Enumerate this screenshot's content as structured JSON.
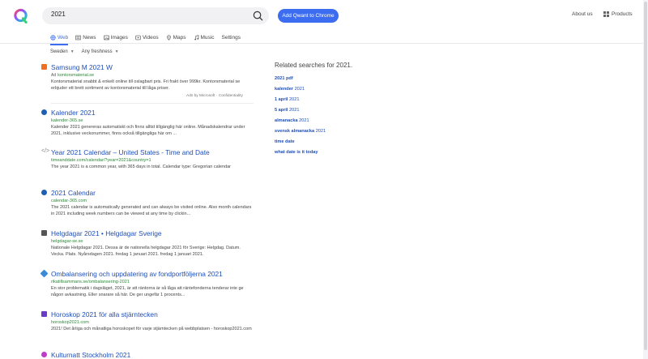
{
  "search": {
    "query": "2021"
  },
  "header": {
    "add_button": "Add Qwant to Chrome",
    "about": "About us",
    "products": "Products"
  },
  "tabs": [
    {
      "label": "Web"
    },
    {
      "label": "News"
    },
    {
      "label": "Images"
    },
    {
      "label": "Videos"
    },
    {
      "label": "Maps"
    },
    {
      "label": "Music"
    },
    {
      "label": "Settings"
    }
  ],
  "filters": {
    "region": "Sweden",
    "freshness": "Any freshness"
  },
  "results": [
    {
      "title": "Samsung M 2021 W",
      "ad_badge": "Ad",
      "url": "kontorsmaterial.se",
      "desc": "Kontorsmaterial snabbt & enkelt online till oslagbart pris. Fri frakt över 999kr. Kontorsmaterial se erbjuder ett brett sortiment av kontorsmaterial till låga priser.",
      "ad_meta": "Ads by Microsoft · Confidentiality",
      "favicon_color": "#f07020"
    },
    {
      "title": "Kalender 2021",
      "url": "kalender-365.se",
      "desc": "Kalender 2021 genereras automatiskt och finns alltid tillgänglig här online. Månadskalendrar under 2021, inklusive veckonummer, finns också tillgängliga här om ...",
      "favicon_color": "#1e5fb3"
    },
    {
      "title": "Year 2021 Calendar – United States - Time and Date",
      "url": "timeanddate.com/calendar/?year=2021&country=1",
      "desc": "The year 2021 is a common year, with 365 days in total. Calendar type: Gregorian calendar",
      "favicon_color": "#8a8a8a"
    },
    {
      "title": "2021 Calendar",
      "url": "calendar-365.com",
      "desc": "The 2021 calendar is automatically generated and can always be visited online. Also month calendars in 2021 including week numbers can be viewed at any time by clickin...",
      "favicon_color": "#1e5fb3"
    },
    {
      "title": "Helgdagar 2021 • Helgdagar Sverige",
      "url": "helgdagar-se.se",
      "desc": "Nationale Helgdagar 2021. Dessa är de nationella helgdagar 2021 för Sverige: Helgdag. Datum. Vecka. Plats. Nyårsdagen 2021. fredag 1 januari 2021. fredag 1 januari 2021.",
      "favicon_color": "#555555"
    },
    {
      "title": "Ombalansering och uppdatering av fondportföljerna 2021",
      "url": "rikatillsammans.se/ombalansering-2021",
      "desc": "En stor problematik i dagsläget, 2021, är att räntorna är så låga att räntefonderna tenderar inte ge någon avkastning. Eller snarare så här. De ger ungefär 1 procents...",
      "favicon_color": "#3a8ad6"
    },
    {
      "title": "Horoskop 2021 för alla stjärntecken",
      "url": "horoskop2021.com",
      "desc": "2021! Det årliga och månatliga horoskopet för varje stjärntecken på webbplatsen - horoskop2021.com",
      "favicon_color": "#6a3cc8"
    },
    {
      "title": "Kulturnatt Stockholm 2021",
      "url": "",
      "desc": "",
      "favicon_color": "#c03cc8"
    }
  ],
  "related": {
    "title": "Related searches for 2021.",
    "items": [
      {
        "bold": "2021 pdf",
        "rest": ""
      },
      {
        "bold": "kalender",
        "rest": " 2021"
      },
      {
        "bold": "1 april",
        "rest": " 2021"
      },
      {
        "bold": "5 april",
        "rest": " 2021"
      },
      {
        "bold": "almanacka",
        "rest": " 2021"
      },
      {
        "bold": "svensk almanacka",
        "rest": " 2021"
      },
      {
        "bold": "time date",
        "rest": ""
      },
      {
        "bold": "what date is it today",
        "rest": ""
      }
    ]
  },
  "colors": {
    "accent": "#3c6df0",
    "link": "#1f4fb7",
    "url": "#2a8a36"
  },
  "icons": [
    "qwant-logo",
    "search-icon",
    "grid-icon",
    "globe-icon",
    "news-icon",
    "image-icon",
    "video-icon",
    "map-pin-icon",
    "music-icon"
  ]
}
